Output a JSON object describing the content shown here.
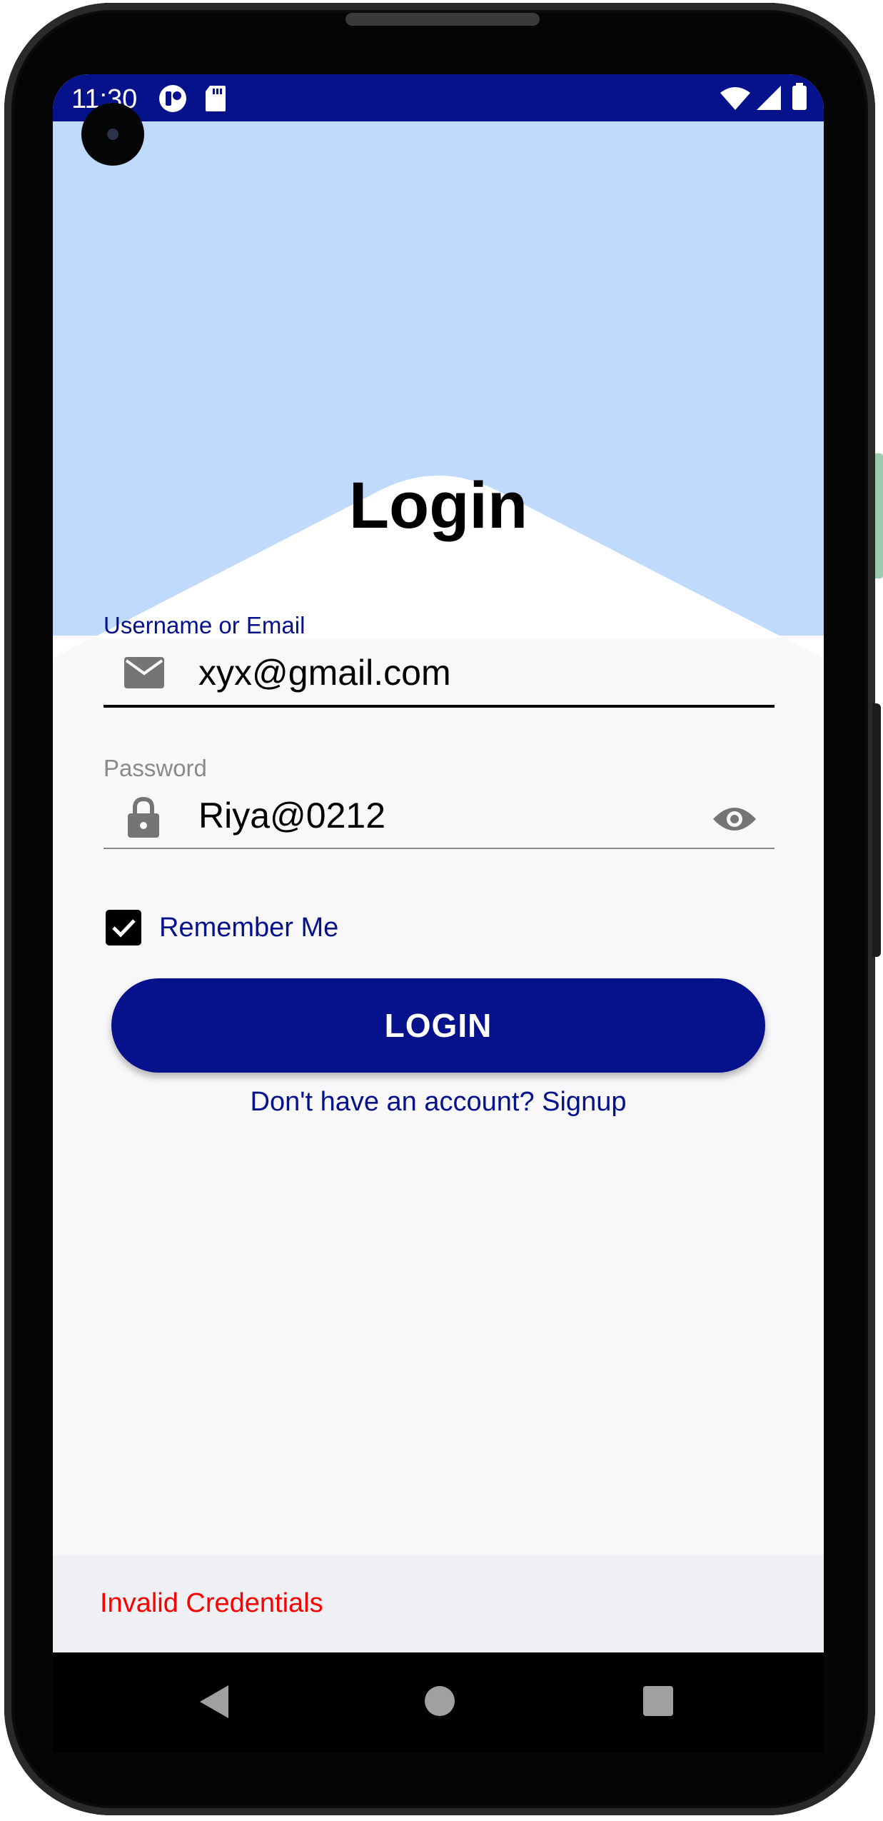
{
  "status_bar": {
    "time": "11:30",
    "left_icons": [
      "t-app-icon",
      "sd-card-icon"
    ],
    "right_icons": [
      "wifi-icon",
      "signal-icon",
      "battery-icon"
    ],
    "color": "#06118c"
  },
  "header": {
    "title": "Login",
    "background_color": "#bfdafd"
  },
  "form": {
    "username": {
      "label": "Username or Email",
      "value": "xyx@gmail.com",
      "icon": "envelope-icon",
      "focused": true
    },
    "password": {
      "label": "Password",
      "value": "Riya@0212",
      "icon": "lock-icon",
      "toggle_icon": "eye-icon",
      "focused": false
    },
    "remember_me": {
      "label": "Remember Me",
      "checked": true
    },
    "login_button_label": "LOGIN",
    "signup_link": "Don't have an account? Signup"
  },
  "snackbar": {
    "message": "Invalid Credentials",
    "color": "#ff0000"
  },
  "nav_bar": {
    "buttons": [
      "back-icon",
      "home-icon",
      "recents-icon"
    ]
  },
  "colors": {
    "primary": "#06118c",
    "screen_bg": "#f8f8fa",
    "icon_gray": "#757575"
  }
}
